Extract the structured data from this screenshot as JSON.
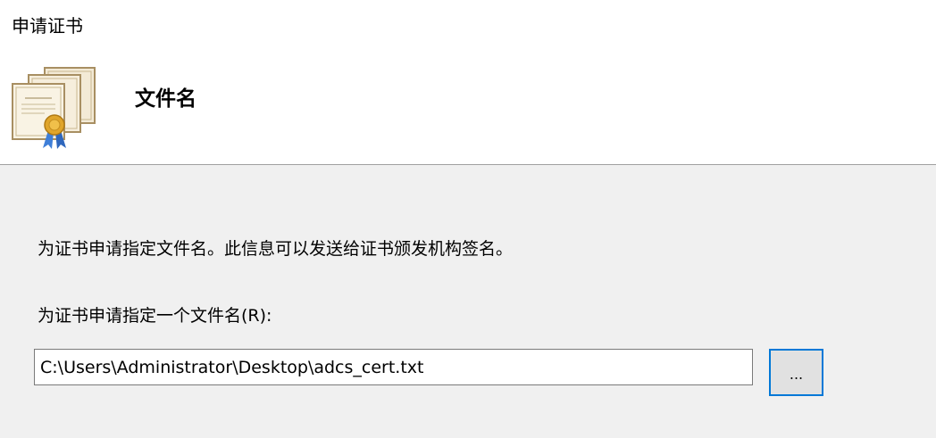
{
  "window": {
    "title": "申请证书"
  },
  "header": {
    "icon": "certificate-icon",
    "heading": "文件名"
  },
  "main": {
    "description": "为证书申请指定文件名。此信息可以发送给证书颁发机构签名。",
    "field_label": "为证书申请指定一个文件名(R):",
    "filename_value": "C:\\Users\\Administrator\\Desktop\\adcs_cert.txt",
    "browse_label": "..."
  },
  "colors": {
    "header_bg": "#ffffff",
    "body_bg": "#f0f0f0",
    "accent": "#0078d7",
    "seal_gold": "#e0a52a",
    "ribbon_blue": "#3f7fd8"
  }
}
